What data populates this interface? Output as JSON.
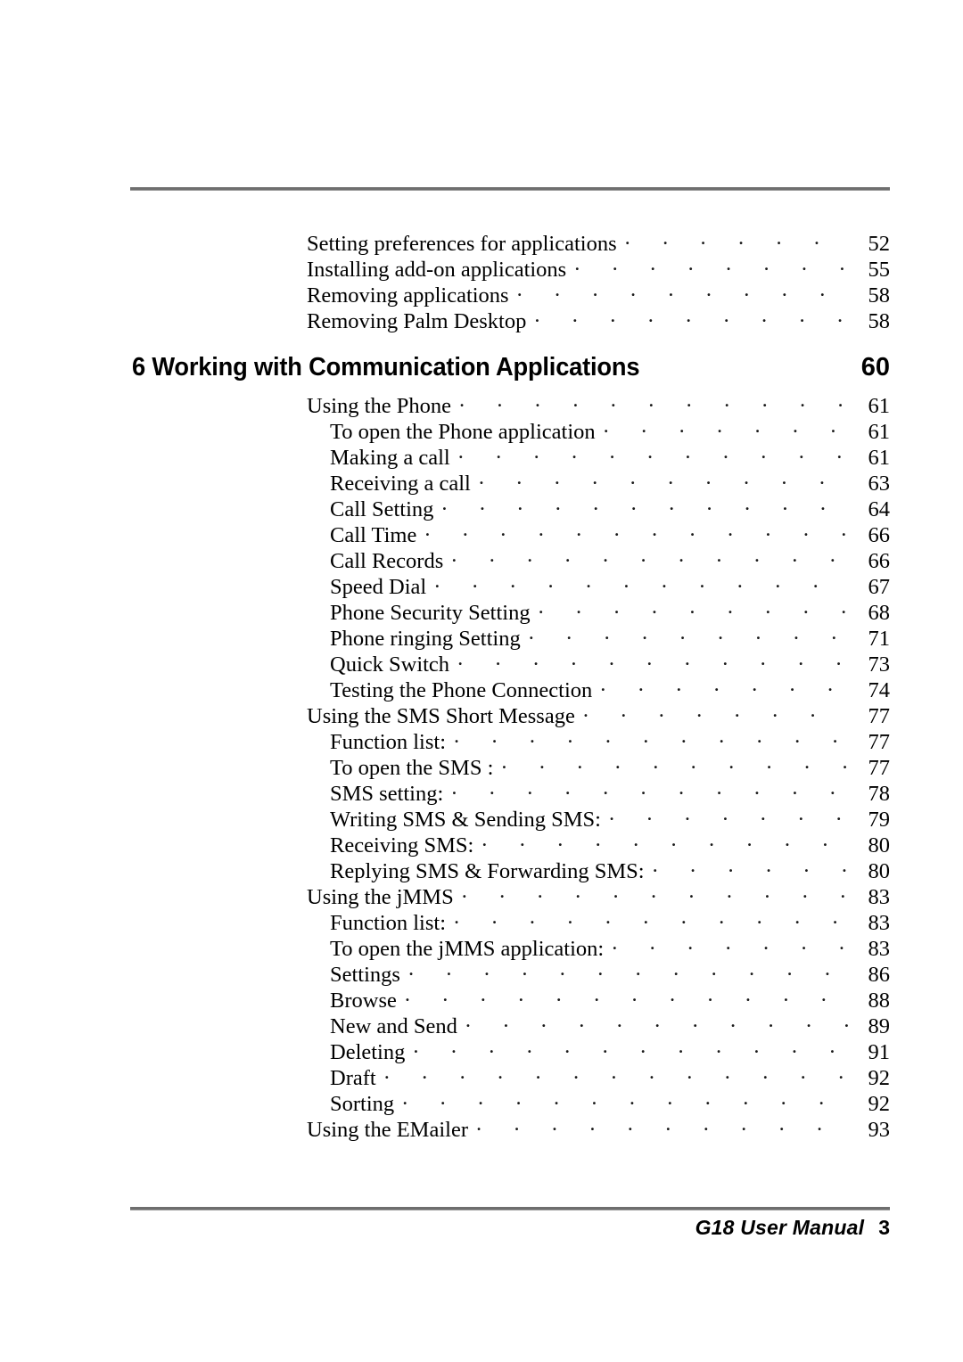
{
  "document": {
    "type": "table-of-contents",
    "footer": {
      "manual_title": "G18 User Manual",
      "page_number": "3"
    }
  },
  "toc": {
    "top_entries": [
      {
        "label": "Setting preferences for applications",
        "page": "52",
        "level": 1
      },
      {
        "label": "Installing add-on applications",
        "page": "55",
        "level": 1
      },
      {
        "label": "Removing applications",
        "page": "58",
        "level": 1
      },
      {
        "label": "Removing Palm Desktop",
        "page": "58",
        "level": 1
      }
    ],
    "chapter": {
      "number": "6",
      "title": "6 Working with Communication Applications",
      "page": "60"
    },
    "chapter_entries": [
      {
        "label": "Using the Phone",
        "page": "61",
        "level": 1
      },
      {
        "label": "To open the Phone application",
        "page": "61",
        "level": 2
      },
      {
        "label": "Making a call",
        "page": "61",
        "level": 2
      },
      {
        "label": "Receiving a call",
        "page": "63",
        "level": 2
      },
      {
        "label": "Call Setting",
        "page": "64",
        "level": 2
      },
      {
        "label": "Call Time",
        "page": "66",
        "level": 2
      },
      {
        "label": "Call Records",
        "page": "66",
        "level": 2
      },
      {
        "label": "Speed Dial",
        "page": "67",
        "level": 2
      },
      {
        "label": "Phone Security Setting",
        "page": "68",
        "level": 2
      },
      {
        "label": "Phone ringing Setting",
        "page": "71",
        "level": 2
      },
      {
        "label": "Quick Switch",
        "page": "73",
        "level": 2
      },
      {
        "label": "Testing the Phone Connection",
        "page": "74",
        "level": 2
      },
      {
        "label": "Using the SMS Short Message",
        "page": "77",
        "level": 1
      },
      {
        "label": "Function list:",
        "page": "77",
        "level": 2
      },
      {
        "label": "To open the SMS :",
        "page": "77",
        "level": 2
      },
      {
        "label": "SMS setting:",
        "page": "78",
        "level": 2
      },
      {
        "label": "Writing SMS & Sending SMS:",
        "page": "79",
        "level": 2
      },
      {
        "label": "Receiving SMS:",
        "page": "80",
        "level": 2
      },
      {
        "label": "Replying SMS & Forwarding SMS:",
        "page": "80",
        "level": 2
      },
      {
        "label": "Using the jMMS",
        "page": "83",
        "level": 1
      },
      {
        "label": "Function list:",
        "page": "83",
        "level": 2
      },
      {
        "label": "To open the jMMS application:",
        "page": "83",
        "level": 2
      },
      {
        "label": "Settings",
        "page": "86",
        "level": 2
      },
      {
        "label": "Browse",
        "page": "88",
        "level": 2
      },
      {
        "label": "New and Send",
        "page": "89",
        "level": 2
      },
      {
        "label": "Deleting",
        "page": "91",
        "level": 2
      },
      {
        "label": "Draft",
        "page": "92",
        "level": 2
      },
      {
        "label": "Sorting",
        "page": "92",
        "level": 2
      },
      {
        "label": "Using the EMailer",
        "page": "93",
        "level": 1
      }
    ]
  }
}
